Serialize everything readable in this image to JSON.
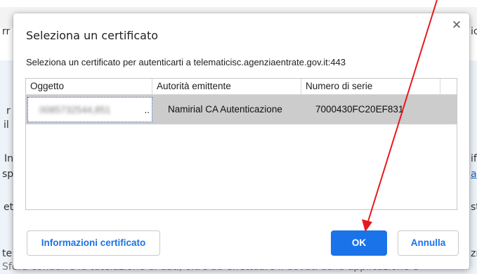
{
  "dialog": {
    "title": "Seleziona un certificato",
    "close_symbol": "✕",
    "description": "Seleziona un certificato per autenticarti a telematicisc.agenziaentrate.gov.it:443"
  },
  "table": {
    "columns": [
      "Oggetto",
      "Autorità emittente",
      "Numero di serie"
    ],
    "rows": [
      {
        "subject": "0085732544,851",
        "subject_ellipsis": "..",
        "issuer": "Namirial CA Autenticazione",
        "serial": "7000430FC20EF831"
      }
    ]
  },
  "buttons": {
    "info": "Informazioni certificato",
    "ok": "OK",
    "cancel": "Annulla"
  },
  "background_fragments": [
    "rr",
    "ic",
    "r",
    "il",
    "In",
    "if",
    "sp",
    "a",
    "et",
    "st",
    "te",
    "zı",
    "Sfera condurre la tutelazione di dati, oltre ad effettuare il dovuti dalla applicazione è"
  ],
  "colors": {
    "accent": "#1a73e8",
    "annotation_arrow": "#e8191d",
    "selected_row": "#cccccc"
  }
}
